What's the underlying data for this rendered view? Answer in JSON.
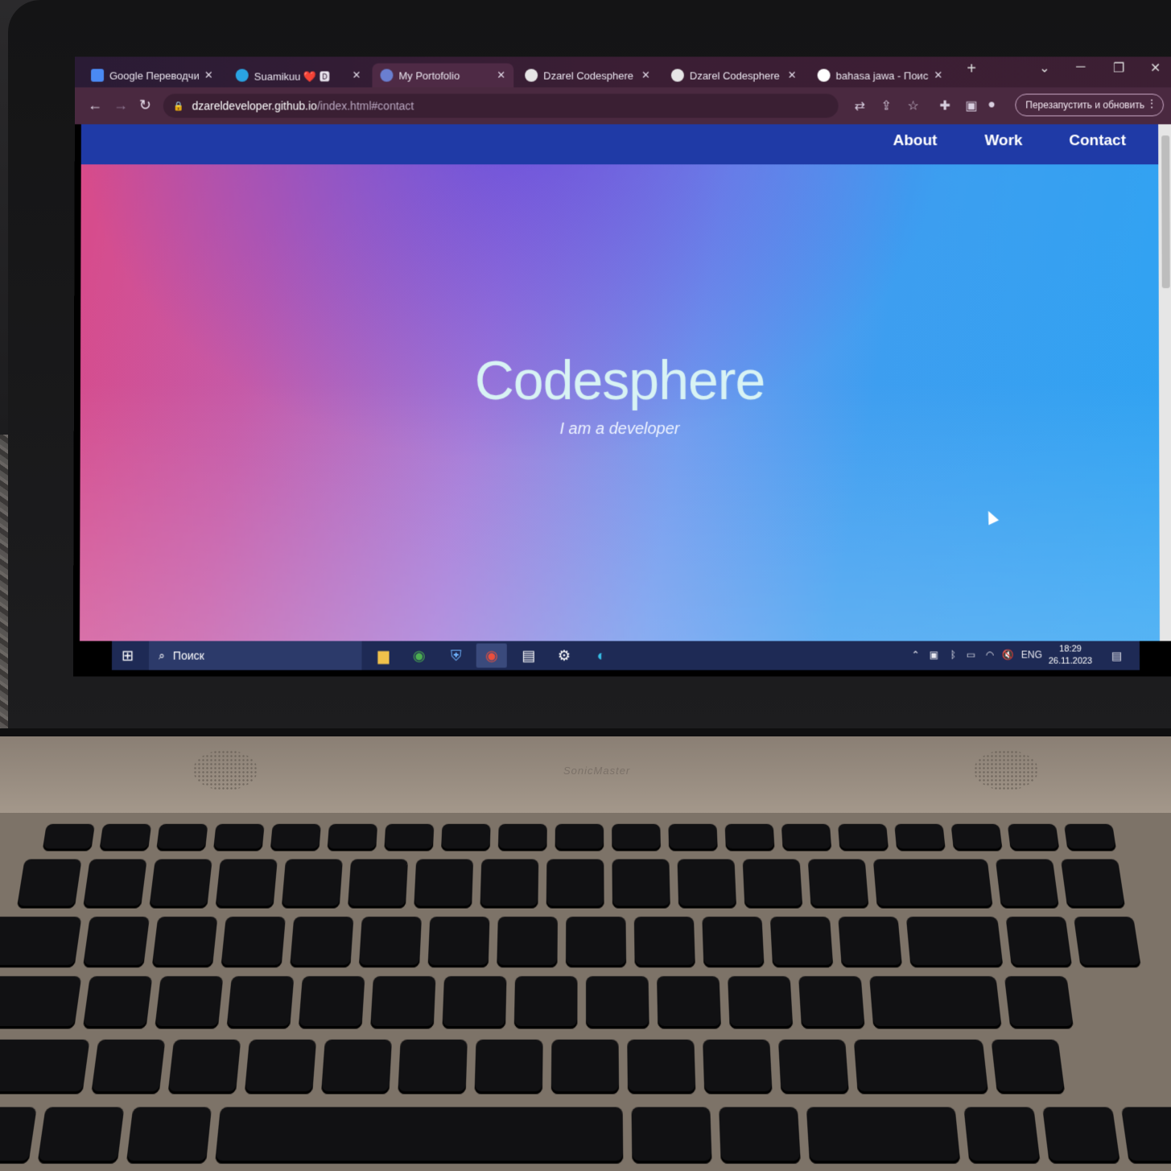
{
  "browser": {
    "tabs": [
      {
        "title": "Google Переводчик",
        "icon": "google-translate-icon",
        "color": "#4a8af4"
      },
      {
        "title": "Suamikuu ❤️ 🅳",
        "icon": "telegram-icon",
        "color": "#2aa3e2"
      },
      {
        "title": "My Portofolio",
        "icon": "globe-icon",
        "color": "#6a7fd0",
        "active": true
      },
      {
        "title": "Dzarel Codesphere c",
        "icon": "codesphere-icon",
        "color": "#e6e6e6"
      },
      {
        "title": "Dzarel Codesphere c",
        "icon": "codesphere-icon",
        "color": "#e6e6e6"
      },
      {
        "title": "bahasa jawa - Поис",
        "icon": "google-icon",
        "color": "#ffffff"
      }
    ],
    "new_tab_label": "+",
    "address": {
      "domain": "dzareldeveloper.github.io",
      "path": "/index.html#contact"
    },
    "relaunch_label": "Перезапустить и обновить",
    "relaunch_menu": "⋮"
  },
  "site": {
    "nav": [
      {
        "label": "About"
      },
      {
        "label": "Work"
      },
      {
        "label": "Contact"
      }
    ],
    "hero_title": "Codesphere",
    "hero_subtitle": "I am a developer",
    "colors": {
      "nav": "#1f3aa6",
      "gradient_left": "#d94a88",
      "gradient_right": "#2fa3f2"
    }
  },
  "taskbar": {
    "search_placeholder": "Поиск",
    "apps": [
      "file-explorer-icon",
      "chrome-icon",
      "shield-icon",
      "chrome-profile-icon",
      "pdf-icon",
      "settings-icon",
      "edge-icon"
    ],
    "language": "ENG",
    "time": "18:29",
    "date": "26.11.2023"
  },
  "laptop": {
    "brand_text": "SonicMaster"
  }
}
